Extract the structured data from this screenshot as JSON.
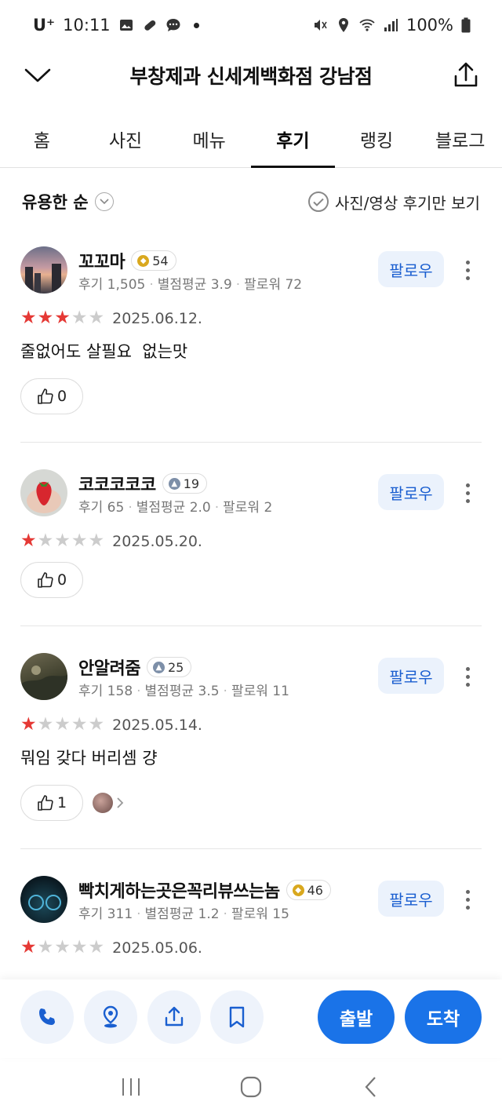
{
  "status_bar": {
    "carrier": "U⁺",
    "time": "10:11",
    "battery": "100%"
  },
  "header": {
    "title": "부창제과 신세계백화점 강남점"
  },
  "tabs": [
    {
      "label": "홈",
      "active": false
    },
    {
      "label": "사진",
      "active": false
    },
    {
      "label": "메뉴",
      "active": false
    },
    {
      "label": "후기",
      "active": true
    },
    {
      "label": "랭킹",
      "active": false
    },
    {
      "label": "블로그",
      "active": false
    }
  ],
  "filter": {
    "sort_label": "유용한 순",
    "photo_only_label": "사진/영상 후기만 보기"
  },
  "reviews": [
    {
      "name": "꼬꼬마",
      "badge": "54",
      "badge_tier": "gold",
      "review_count": "후기 1,505",
      "avg_rating": "별점평균 3.9",
      "followers": "팔로워 72",
      "follow_label": "팔로우",
      "stars": 3,
      "date": "2025.06.12.",
      "text": "줄없어도 살필요  없는맛",
      "likes": "0"
    },
    {
      "name": "코코코코코",
      "badge": "19",
      "badge_tier": "blue",
      "review_count": "후기 65",
      "avg_rating": "별점평균 2.0",
      "followers": "팔로워 2",
      "follow_label": "팔로우",
      "stars": 1,
      "date": "2025.05.20.",
      "text": "",
      "likes": "0"
    },
    {
      "name": "안알려줌",
      "badge": "25",
      "badge_tier": "blue",
      "review_count": "후기 158",
      "avg_rating": "별점평균 3.5",
      "followers": "팔로워 11",
      "follow_label": "팔로우",
      "stars": 1,
      "date": "2025.05.14.",
      "text": "뭐임 갖다 버리셈 걍",
      "likes": "1"
    },
    {
      "name": "빡치게하는곳은꼭리뷰쓰는놈",
      "badge": "46",
      "badge_tier": "gold",
      "review_count": "후기 311",
      "avg_rating": "별점평균 1.2",
      "followers": "팔로워 15",
      "follow_label": "팔로우",
      "stars": 1,
      "date": "2025.05.06.",
      "text": "",
      "likes": ""
    }
  ],
  "action_bar": {
    "depart_label": "출발",
    "arrive_label": "도착"
  },
  "colors": {
    "accent": "#1a73e8",
    "star": "#e53935",
    "follow_bg": "#ebf2fc"
  }
}
